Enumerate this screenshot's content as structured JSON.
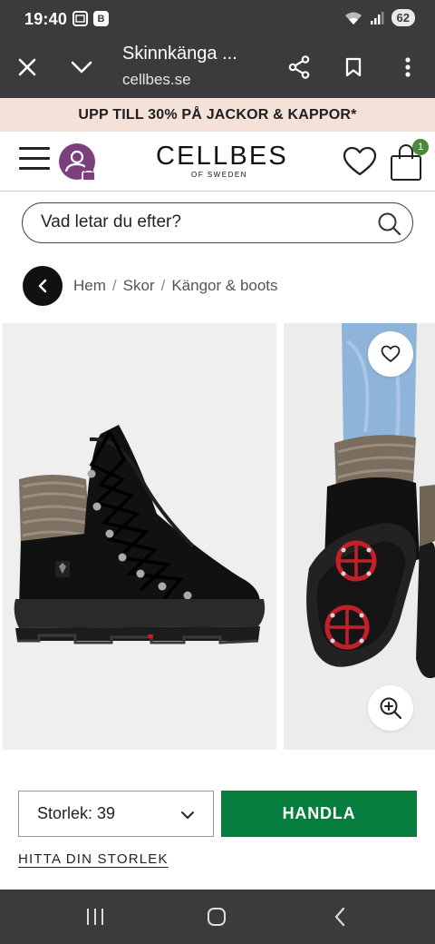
{
  "status_bar": {
    "time": "19:40",
    "notif_icons": [
      "screenshot-icon",
      "b-app-icon"
    ],
    "b_label": "B",
    "battery": "62"
  },
  "browser": {
    "title": "Skinnkänga ...",
    "url": "cellbes.se",
    "icons": [
      "close-icon",
      "chevron-down-icon",
      "share-icon",
      "bookmark-icon",
      "more-vert-icon"
    ]
  },
  "promo": {
    "text": "UPP TILL 30% PÅ JACKOR & KAPPOR*"
  },
  "header": {
    "logo_main": "CELLBES",
    "logo_sub": "OF SWEDEN",
    "cart_count": "1",
    "colors": {
      "avatar": "#7b3f7c",
      "badge": "#4a8a3c"
    }
  },
  "search": {
    "placeholder": "Vad letar du efter?"
  },
  "breadcrumb": {
    "items": [
      "Hem",
      "Skor",
      "Kängor & boots"
    ],
    "separator": "/"
  },
  "product": {
    "size_label": "Storlek: 39",
    "buy_label": "HANDLA",
    "find_size_label": "HITTA DIN STORLEK",
    "colors": {
      "buy_button": "#067d3c"
    }
  },
  "nav_bar": {
    "icons": [
      "recents-icon",
      "home-icon",
      "back-icon"
    ]
  }
}
